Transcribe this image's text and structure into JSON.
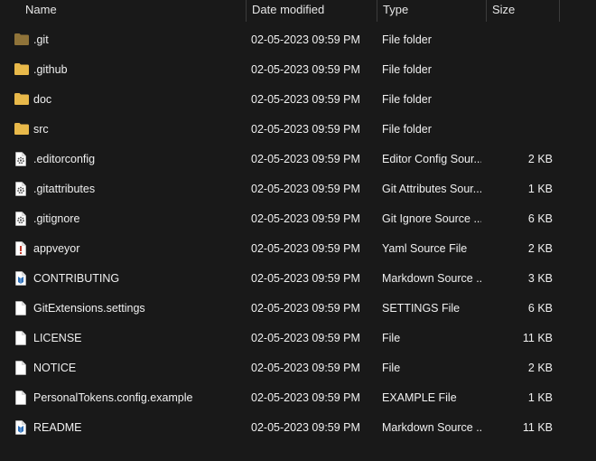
{
  "columns": {
    "name": "Name",
    "date": "Date modified",
    "type": "Type",
    "size": "Size"
  },
  "sort_glyph": "^",
  "colors": {
    "background": "#191919",
    "folder": "#e8b84a",
    "folder_git": "#8f7339",
    "text": "#f0f0f0"
  },
  "files": [
    {
      "icon": "folder-git-icon",
      "name": ".git",
      "date": "02-05-2023 09:59 PM",
      "type": "File folder",
      "size": ""
    },
    {
      "icon": "folder-icon",
      "name": ".github",
      "date": "02-05-2023 09:59 PM",
      "type": "File folder",
      "size": ""
    },
    {
      "icon": "folder-icon",
      "name": "doc",
      "date": "02-05-2023 09:59 PM",
      "type": "File folder",
      "size": ""
    },
    {
      "icon": "folder-icon",
      "name": "src",
      "date": "02-05-2023 09:59 PM",
      "type": "File folder",
      "size": ""
    },
    {
      "icon": "gear-file-icon",
      "name": ".editorconfig",
      "date": "02-05-2023 09:59 PM",
      "type": "Editor Config Sour...",
      "size": "2 KB"
    },
    {
      "icon": "gear-file-icon",
      "name": ".gitattributes",
      "date": "02-05-2023 09:59 PM",
      "type": "Git Attributes Sour...",
      "size": "1 KB"
    },
    {
      "icon": "gear-file-icon",
      "name": ".gitignore",
      "date": "02-05-2023 09:59 PM",
      "type": "Git Ignore Source ...",
      "size": "6 KB"
    },
    {
      "icon": "yaml-file-icon",
      "name": "appveyor",
      "date": "02-05-2023 09:59 PM",
      "type": "Yaml Source File",
      "size": "2 KB"
    },
    {
      "icon": "markdown-file-icon",
      "name": "CONTRIBUTING",
      "date": "02-05-2023 09:59 PM",
      "type": "Markdown Source ...",
      "size": "3 KB"
    },
    {
      "icon": "blank-file-icon",
      "name": "GitExtensions.settings",
      "date": "02-05-2023 09:59 PM",
      "type": "SETTINGS File",
      "size": "6 KB"
    },
    {
      "icon": "blank-file-icon",
      "name": "LICENSE",
      "date": "02-05-2023 09:59 PM",
      "type": "File",
      "size": "11 KB"
    },
    {
      "icon": "blank-file-icon",
      "name": "NOTICE",
      "date": "02-05-2023 09:59 PM",
      "type": "File",
      "size": "2 KB"
    },
    {
      "icon": "blank-file-icon",
      "name": "PersonalTokens.config.example",
      "date": "02-05-2023 09:59 PM",
      "type": "EXAMPLE File",
      "size": "1 KB"
    },
    {
      "icon": "markdown-file-icon",
      "name": "README",
      "date": "02-05-2023 09:59 PM",
      "type": "Markdown Source ...",
      "size": "11 KB"
    }
  ]
}
